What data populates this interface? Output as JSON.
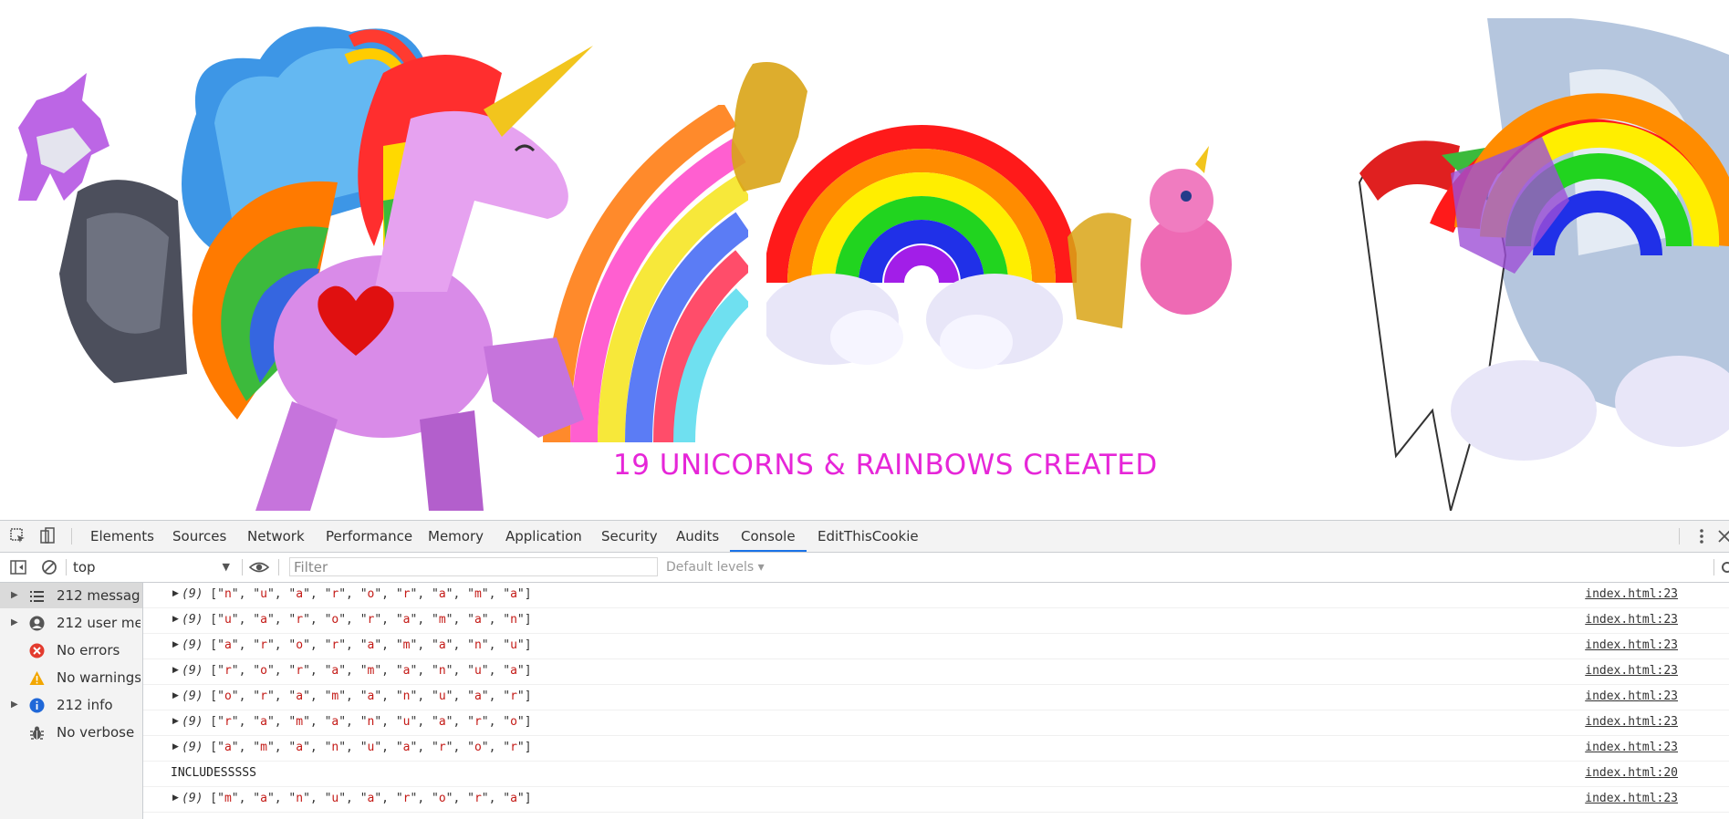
{
  "page": {
    "banner_text": "19 UNICORNS & RAINBOWS CREATED"
  },
  "devtools": {
    "tabs": [
      "Elements",
      "Sources",
      "Network",
      "Performance",
      "Memory",
      "Application",
      "Security",
      "Audits",
      "Console",
      "EditThisCookie"
    ],
    "active_tab": "Console",
    "toolbar": {
      "context": "top",
      "filter_placeholder": "Filter",
      "levels": "Default levels ▾"
    },
    "sidebar": [
      {
        "label": "212 messag...",
        "icon": "list-icon",
        "expandable": true
      },
      {
        "label": "212 user me...",
        "icon": "user-icon",
        "expandable": true
      },
      {
        "label": "No errors",
        "icon": "error-icon",
        "expandable": false
      },
      {
        "label": "No warnings",
        "icon": "warning-icon",
        "expandable": false
      },
      {
        "label": "212 info",
        "icon": "info-icon",
        "expandable": true
      },
      {
        "label": "No verbose",
        "icon": "bug-icon",
        "expandable": false
      }
    ],
    "console_rows": [
      {
        "count": "(9)",
        "items": [
          "n",
          "u",
          "a",
          "r",
          "o",
          "r",
          "a",
          "m",
          "a"
        ],
        "source": "index.html:23"
      },
      {
        "count": "(9)",
        "items": [
          "u",
          "a",
          "r",
          "o",
          "r",
          "a",
          "m",
          "a",
          "n"
        ],
        "source": "index.html:23"
      },
      {
        "count": "(9)",
        "items": [
          "a",
          "r",
          "o",
          "r",
          "a",
          "m",
          "a",
          "n",
          "u"
        ],
        "source": "index.html:23"
      },
      {
        "count": "(9)",
        "items": [
          "r",
          "o",
          "r",
          "a",
          "m",
          "a",
          "n",
          "u",
          "a"
        ],
        "source": "index.html:23"
      },
      {
        "count": "(9)",
        "items": [
          "o",
          "r",
          "a",
          "m",
          "a",
          "n",
          "u",
          "a",
          "r"
        ],
        "source": "index.html:23"
      },
      {
        "count": "(9)",
        "items": [
          "r",
          "a",
          "m",
          "a",
          "n",
          "u",
          "a",
          "r",
          "o"
        ],
        "source": "index.html:23"
      },
      {
        "count": "(9)",
        "items": [
          "a",
          "m",
          "a",
          "n",
          "u",
          "a",
          "r",
          "o",
          "r"
        ],
        "source": "index.html:23"
      },
      {
        "text": "INCLUDESSSSS",
        "source": "index.html:20"
      },
      {
        "count": "(9)",
        "items": [
          "m",
          "a",
          "n",
          "u",
          "a",
          "r",
          "o",
          "r",
          "a"
        ],
        "source": "index.html:23"
      }
    ]
  },
  "colors": {
    "banner": "#e626d8",
    "string_red": "#c41a16",
    "active_tab_underline": "#1a73e8"
  }
}
